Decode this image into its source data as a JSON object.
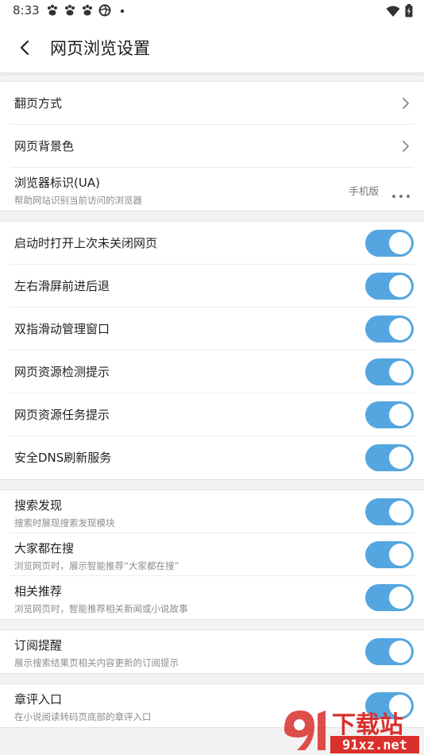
{
  "status_bar": {
    "time": "8:33",
    "notification_icons": [
      "paw-icon",
      "paw-icon",
      "paw-icon",
      "aperture-icon",
      "dot-icon"
    ],
    "right_icons": [
      "wifi-icon",
      "battery-icon"
    ]
  },
  "header": {
    "title": "网页浏览设置"
  },
  "nav_group": [
    {
      "label": "翻页方式",
      "type": "chevron"
    },
    {
      "label": "网页背景色",
      "type": "chevron"
    },
    {
      "label": "浏览器标识(UA)",
      "sub": "帮助网站识别当前访问的浏览器",
      "value": "手机版",
      "type": "more"
    }
  ],
  "toggles_group": [
    {
      "label": "启动时打开上次未关闭网页",
      "on": true
    },
    {
      "label": "左右滑屏前进后退",
      "on": true
    },
    {
      "label": "双指滑动管理窗口",
      "on": true
    },
    {
      "label": "网页资源检测提示",
      "on": true
    },
    {
      "label": "网页资源任务提示",
      "on": true
    },
    {
      "label": "安全DNS刷新服务",
      "on": true
    }
  ],
  "search_group": [
    {
      "label": "搜索发现",
      "sub": "搜索时展现搜索发现模块",
      "on": true
    },
    {
      "label": "大家都在搜",
      "sub": "浏览网页时，展示智能推荐“大家都在搜”",
      "on": true
    },
    {
      "label": "相关推荐",
      "sub": "浏览网页时，智能推荐相关新闻或小说故事",
      "on": true
    }
  ],
  "subscribe_group": [
    {
      "label": "订阅提醒",
      "sub": "展示搜索结果页相关内容更新的订阅提示",
      "on": true
    }
  ],
  "comment_group": [
    {
      "label": "章评入口",
      "sub": "在小说阅读转码页底部的章评入口",
      "on": true
    }
  ],
  "watermark": {
    "logo_text": "下载站",
    "url_text": "91xz.net"
  },
  "colors": {
    "accent": "#55a6e0",
    "background": "#f2f2f2",
    "watermark_red": "#d9302c"
  }
}
